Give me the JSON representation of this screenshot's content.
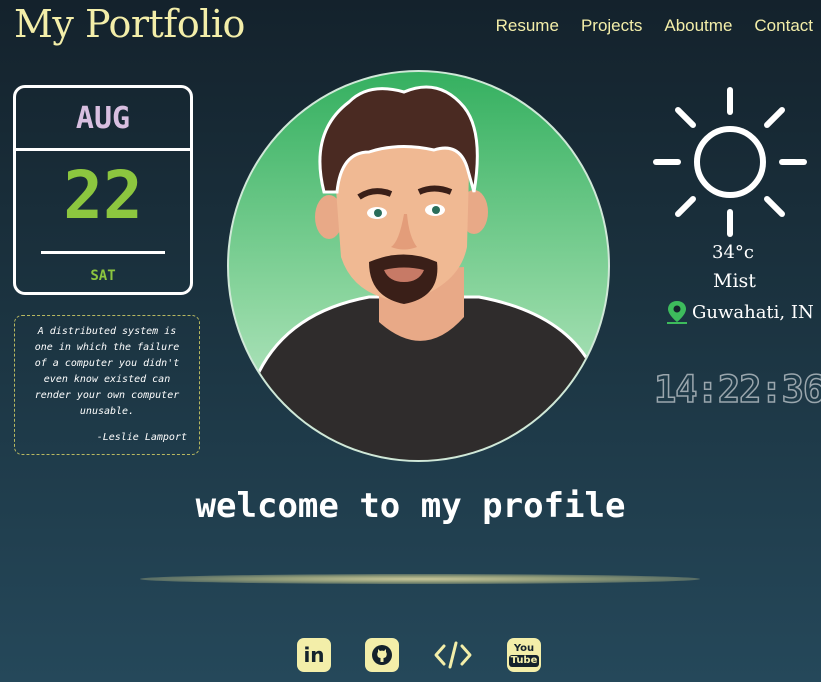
{
  "header": {
    "logo": "My Portfolio",
    "nav": [
      "Resume",
      "Projects",
      "Aboutme",
      "Contact"
    ]
  },
  "calendar": {
    "month": "AUG",
    "day": "22",
    "weekday": "SAT"
  },
  "quote": {
    "text": "A distributed system is one in which the failure of a computer you didn't even know existed can render your own computer unusable.",
    "author": "-Leslie Lamport"
  },
  "weather": {
    "temperature": "34°c",
    "condition": "Mist",
    "location": "Guwahati, IN"
  },
  "clock": "14:22:36",
  "welcome": "welcome to my profile",
  "socials": {
    "linkedin": "in",
    "youtube_top": "You",
    "youtube_bottom": "Tube"
  },
  "colors": {
    "accent": "#f3eea9",
    "calendar_day": "#8cc63f",
    "calendar_month": "#d8bfe0",
    "avatar_bg": "#35b060"
  },
  "icons": [
    "sun-icon",
    "map-pin-icon",
    "linkedin-icon",
    "github-icon",
    "code-icon",
    "youtube-icon"
  ]
}
